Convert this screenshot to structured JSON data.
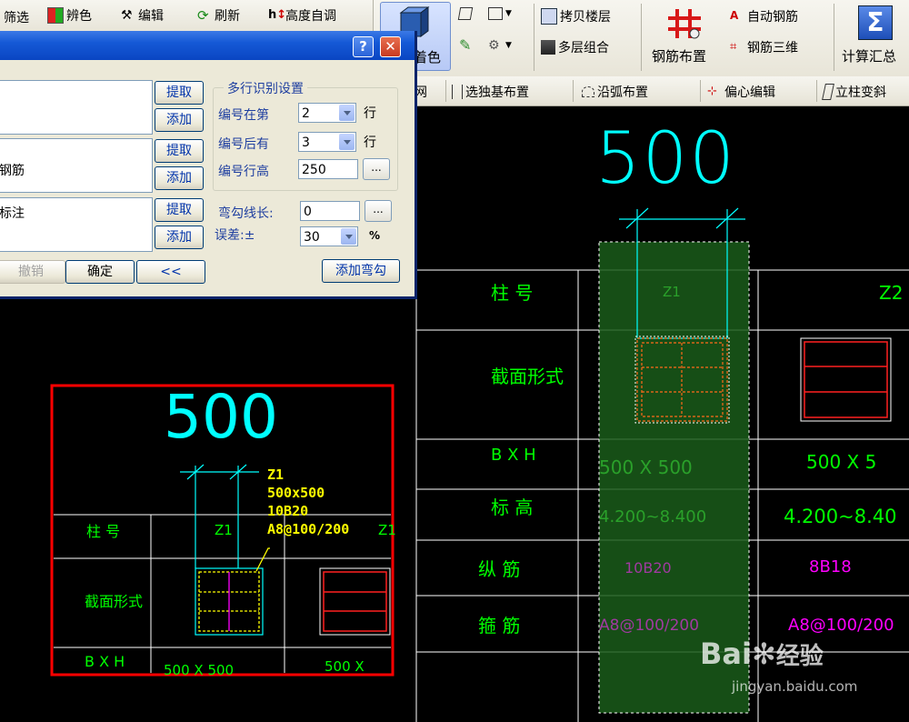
{
  "toolbar": {
    "filter": "筛选",
    "distinguish": "辨色",
    "edit": "编辑",
    "refresh": "刷新",
    "height_adjust": "高度自调",
    "copy_floor": "拷贝楼层",
    "multi_floor_combine": "多层组合",
    "coloring": "着色",
    "rebar_layout": "钢筋布置",
    "auto_rebar": "自动钢筋",
    "rebar_3d": "钢筋三维",
    "calc_summary": "计算汇总",
    "grid_frag": "网",
    "select_independent": "选独基布置",
    "arc_layout": "沿弧布置",
    "eccentric_edit": "偏心编辑",
    "column_deform": "立柱变斜"
  },
  "dialog": {
    "help": "?",
    "close": "✕",
    "list1_text": "",
    "list2_text": "钢筋",
    "list3_text": "标注",
    "extract": "提取",
    "add": "添加",
    "undo": "撤销",
    "ok": "确定",
    "back": "<<",
    "group_title": "多行识别设置",
    "num_at_line_label": "编号在第",
    "num_at_line_value": "2",
    "line_unit": "行",
    "num_after_label": "编号后有",
    "num_after_value": "3",
    "num_row_height_label": "编号行高",
    "num_row_height_value": "250",
    "dots": "...",
    "hook_len_label": "弯勾线长:",
    "hook_len_value": "0",
    "tolerance_label": "误差:±",
    "tolerance_value": "30",
    "percent": "%",
    "add_hook": "添加弯勾"
  },
  "cad_left": {
    "dim": "500",
    "col_no": "柱  号",
    "section": "截面形式",
    "bxh": "B X H",
    "z1": "Z1",
    "z1b": "Z1",
    "leader_l1": "Z1",
    "leader_l2": "500x500",
    "leader_l3": "10B20",
    "leader_l4": "A8@100/200",
    "bxh_val": "500 X 500",
    "bxh_val2": "500 X"
  },
  "cad_right": {
    "dim": "500",
    "col_no": "柱   号",
    "section": "截面形式",
    "bxh": "B  X  H",
    "elev": "标    高",
    "long_rebar": "纵 筋",
    "stirrup": "箍 筋",
    "z1": "Z1",
    "z2": "Z2",
    "bxh_v1": "500 X 500",
    "bxh_v2": "500 X 5",
    "elev_v1": "4.200~8.400",
    "elev_v2": "4.200~8.40",
    "long_v1": "10B20",
    "long_v2": "8B18",
    "stir_v1": "A8@100/200",
    "stir_v2": "A8@100/200"
  },
  "watermark": {
    "brand": "Bai",
    "brand2": "经验",
    "url": "jingyan.baidu.com"
  },
  "colors": {
    "cad_green": "#00ff00",
    "cad_cyan": "#00ffff",
    "cad_yellow": "#ffff00",
    "cad_magenta": "#ff00ff",
    "cad_red": "#ff0000"
  }
}
